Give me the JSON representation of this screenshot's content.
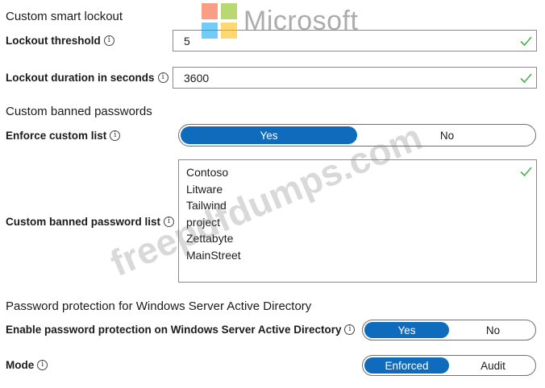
{
  "watermark": {
    "logo_text": "Microsoft",
    "site_text": "freepdfdumps.com"
  },
  "smart_lockout": {
    "section_title": "Custom smart lockout",
    "threshold_label": "Lockout threshold",
    "threshold_value": "5",
    "duration_label": "Lockout duration in seconds",
    "duration_value": "3600"
  },
  "banned_passwords": {
    "section_title": "Custom banned passwords",
    "enforce_label": "Enforce custom list",
    "enforce_options": {
      "yes": "Yes",
      "no": "No"
    },
    "enforce_selected": "Yes",
    "list_label": "Custom banned password list",
    "list_items": [
      "Contoso",
      "Litware",
      "Tailwind",
      "project",
      "Zettabyte",
      "MainStreet"
    ]
  },
  "ad_protection": {
    "section_title": "Password protection for Windows Server Active Directory",
    "enable_label": "Enable password protection on Windows Server Active Directory",
    "enable_options": {
      "yes": "Yes",
      "no": "No"
    },
    "enable_selected": "Yes",
    "mode_label": "Mode",
    "mode_options": {
      "enforced": "Enforced",
      "audit": "Audit"
    },
    "mode_selected": "Enforced"
  },
  "colors": {
    "accent": "#0f6cbd",
    "check": "#4caf50"
  },
  "icons": {
    "info": "info-icon",
    "valid": "check-icon"
  }
}
